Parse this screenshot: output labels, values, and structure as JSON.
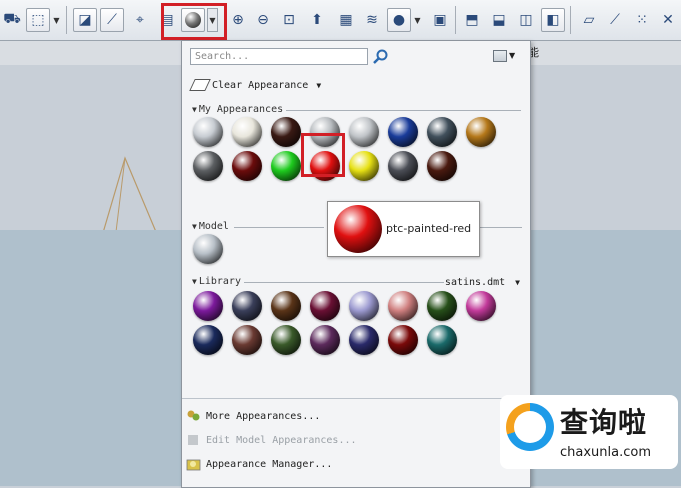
{
  "panel": {
    "search_placeholder": "Search...",
    "clear_appearance_label": "Clear Appearance",
    "sections": {
      "my_appearances": "My Appearances",
      "model": "Model",
      "library": "Library",
      "library_file": "satins.dmt"
    },
    "tooltip_label": "ptc-painted-red",
    "menu": {
      "more_appearances": "More Appearances...",
      "edit_model_appearances": "Edit Model Appearances...",
      "appearance_manager": "Appearance Manager..."
    }
  },
  "my_appearances": [
    {
      "name": "silver",
      "color": "#c7ccd2"
    },
    {
      "name": "pearl",
      "color": "#e8e6dc"
    },
    {
      "name": "dark-brown",
      "color": "#3a1a14"
    },
    {
      "name": "translucent-grey",
      "color": "#b8bcc0"
    },
    {
      "name": "chrome",
      "color": "#c0c4c8"
    },
    {
      "name": "blue",
      "color": "#1a3c9a"
    },
    {
      "name": "slate",
      "color": "#41505c"
    },
    {
      "name": "gold",
      "color": "#b5781a"
    },
    {
      "name": "gunmetal",
      "color": "#5c5f62"
    },
    {
      "name": "maroon",
      "color": "#6b0c0c"
    },
    {
      "name": "green",
      "color": "#1ecb1e"
    },
    {
      "name": "ptc-painted-red",
      "color": "#e01010"
    },
    {
      "name": "yellow",
      "color": "#e6e014"
    },
    {
      "name": "granite",
      "color": "#4b4e56"
    },
    {
      "name": "dark-rust",
      "color": "#4a1a10"
    }
  ],
  "model_appearances": [
    {
      "name": "model-default",
      "color": "#b8c0c8"
    }
  ],
  "library_appearances": [
    {
      "name": "satin-purple",
      "color": "#7c1a9c"
    },
    {
      "name": "satin-slate",
      "color": "#3a3f5a"
    },
    {
      "name": "satin-brown",
      "color": "#5a3418"
    },
    {
      "name": "satin-wine",
      "color": "#6a1034"
    },
    {
      "name": "satin-lavender",
      "color": "#9c9ad0"
    },
    {
      "name": "satin-rose",
      "color": "#d08080"
    },
    {
      "name": "satin-olive",
      "color": "#27501a"
    },
    {
      "name": "satin-pink",
      "color": "#c23a9a"
    },
    {
      "name": "satin-navy",
      "color": "#1a2a5c"
    },
    {
      "name": "satin-cocoa",
      "color": "#6a3a32"
    },
    {
      "name": "satin-moss",
      "color": "#3a5a2a"
    },
    {
      "name": "satin-plum",
      "color": "#5c2a5c"
    },
    {
      "name": "satin-indigo",
      "color": "#2a2a6a"
    },
    {
      "name": "satin-crimson",
      "color": "#7a0a0a"
    },
    {
      "name": "satin-teal",
      "color": "#1a6a6a"
    }
  ],
  "side_label": "能",
  "watermark": {
    "title": "查询啦",
    "url": "chaxunla.com"
  },
  "accent": "#d21f26"
}
